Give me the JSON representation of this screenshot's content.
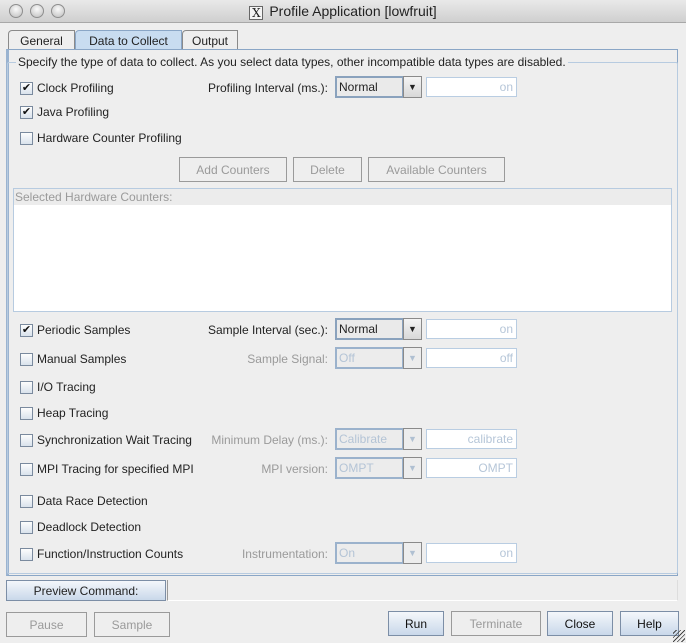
{
  "window": {
    "title": "Profile Application [lowfruit]",
    "app_icon": "x11-icon"
  },
  "tabs": [
    {
      "label": "General",
      "active": false
    },
    {
      "label": "Data to Collect",
      "active": true
    },
    {
      "label": "Output",
      "active": false
    }
  ],
  "instruction": "Specify the type of data to collect.  As you select data types, other incompatible data types are disabled.",
  "options": {
    "clock_profiling": {
      "label": "Clock Profiling",
      "checked": true
    },
    "java_profiling": {
      "label": "Java Profiling",
      "checked": true
    },
    "hw_counter_profiling": {
      "label": "Hardware Counter Profiling",
      "checked": false
    },
    "periodic_samples": {
      "label": "Periodic Samples",
      "checked": true
    },
    "manual_samples": {
      "label": "Manual Samples",
      "checked": false
    },
    "io_tracing": {
      "label": "I/O Tracing",
      "checked": false
    },
    "heap_tracing": {
      "label": "Heap Tracing",
      "checked": false
    },
    "sync_wait_tracing": {
      "label": "Synchronization Wait Tracing",
      "checked": false
    },
    "mpi_tracing": {
      "label": "MPI Tracing for specified MPI",
      "checked": false
    },
    "data_race": {
      "label": "Data Race Detection",
      "checked": false
    },
    "deadlock": {
      "label": "Deadlock Detection",
      "checked": false
    },
    "func_instr_counts": {
      "label": "Function/Instruction Counts",
      "checked": false
    }
  },
  "settings": {
    "profiling_interval": {
      "label": "Profiling Interval (ms.):",
      "selected": "Normal",
      "field": "on",
      "enabled": true
    },
    "sample_interval": {
      "label": "Sample Interval (sec.):",
      "selected": "Normal",
      "field": "on",
      "enabled": true
    },
    "sample_signal": {
      "label": "Sample Signal:",
      "selected": "Off",
      "field": "off",
      "enabled": false
    },
    "minimum_delay": {
      "label": "Minimum Delay (ms.):",
      "selected": "Calibrate",
      "field": "calibrate",
      "enabled": false
    },
    "mpi_version": {
      "label": "MPI version:",
      "selected": "OMPT",
      "field": "OMPT",
      "enabled": false
    },
    "instrumentation": {
      "label": "Instrumentation:",
      "selected": "On",
      "field": "on",
      "enabled": false
    }
  },
  "counter_buttons": {
    "add": "Add Counters",
    "delete": "Delete",
    "available": "Available Counters"
  },
  "hw_counters": {
    "header": "Selected Hardware Counters:",
    "items": []
  },
  "preview": {
    "button": "Preview Command:",
    "value": ""
  },
  "footer": {
    "pause": "Pause",
    "sample": "Sample",
    "run": "Run",
    "terminate": "Terminate",
    "close": "Close",
    "help": "Help"
  }
}
